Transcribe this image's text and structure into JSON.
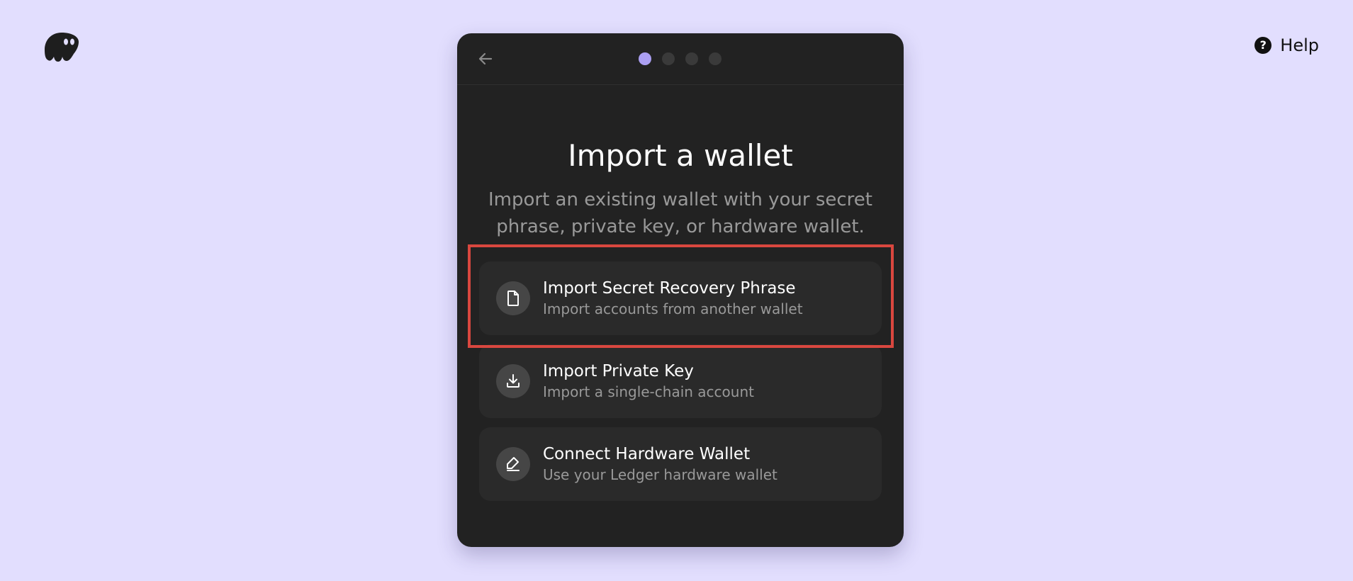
{
  "app": {
    "logo_icon": "phantom-ghost-logo",
    "help_icon": "question-circle-icon",
    "help_label": "Help"
  },
  "header": {
    "back_icon": "arrow-left-icon",
    "steps_total": 4,
    "steps_active": 1,
    "accent_color": "#ab9ff2"
  },
  "main": {
    "title": "Import a wallet",
    "subtitle": "Import an existing wallet with your secret phrase, private key, or hardware wallet.",
    "options": [
      {
        "icon": "document-icon",
        "title": "Import Secret Recovery Phrase",
        "description": "Import accounts from another wallet",
        "highlighted": true
      },
      {
        "icon": "download-icon",
        "title": "Import Private Key",
        "description": "Import a single-chain account",
        "highlighted": false
      },
      {
        "icon": "hardware-wallet-icon",
        "title": "Connect Hardware Wallet",
        "description": "Use your Ledger hardware wallet",
        "highlighted": false
      }
    ]
  },
  "colors": {
    "background": "#e2defe",
    "card": "#222222",
    "option": "#2a2a2a",
    "highlight": "#d9473f"
  }
}
